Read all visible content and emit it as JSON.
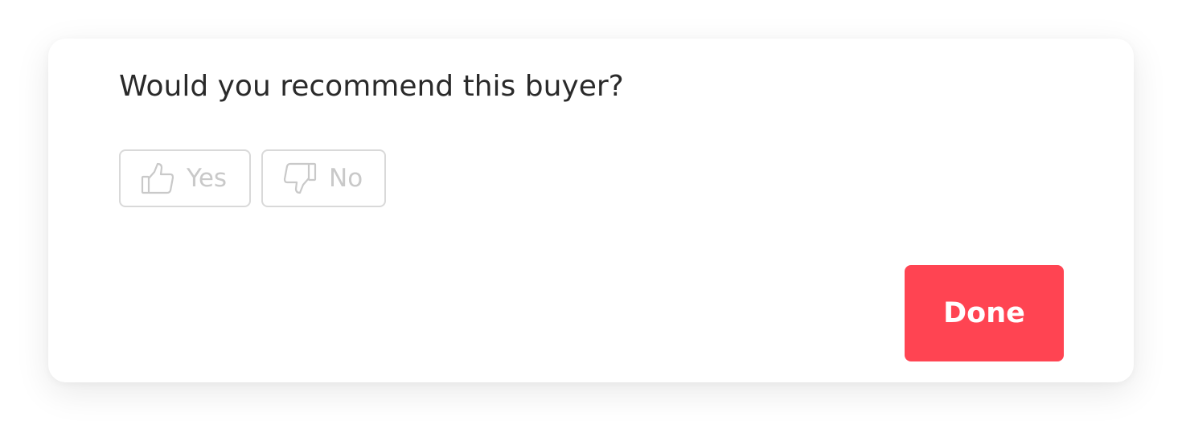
{
  "dialog": {
    "question": "Would you recommend this buyer?",
    "options": [
      {
        "label": "Yes",
        "icon": "thumbs-up-icon"
      },
      {
        "label": "No",
        "icon": "thumbs-down-icon"
      }
    ],
    "done_label": "Done"
  },
  "colors": {
    "accent": "#ff4452",
    "option_border": "#d9d9d9",
    "option_text": "#c9c9c9",
    "question_text": "#2a2a2a"
  }
}
